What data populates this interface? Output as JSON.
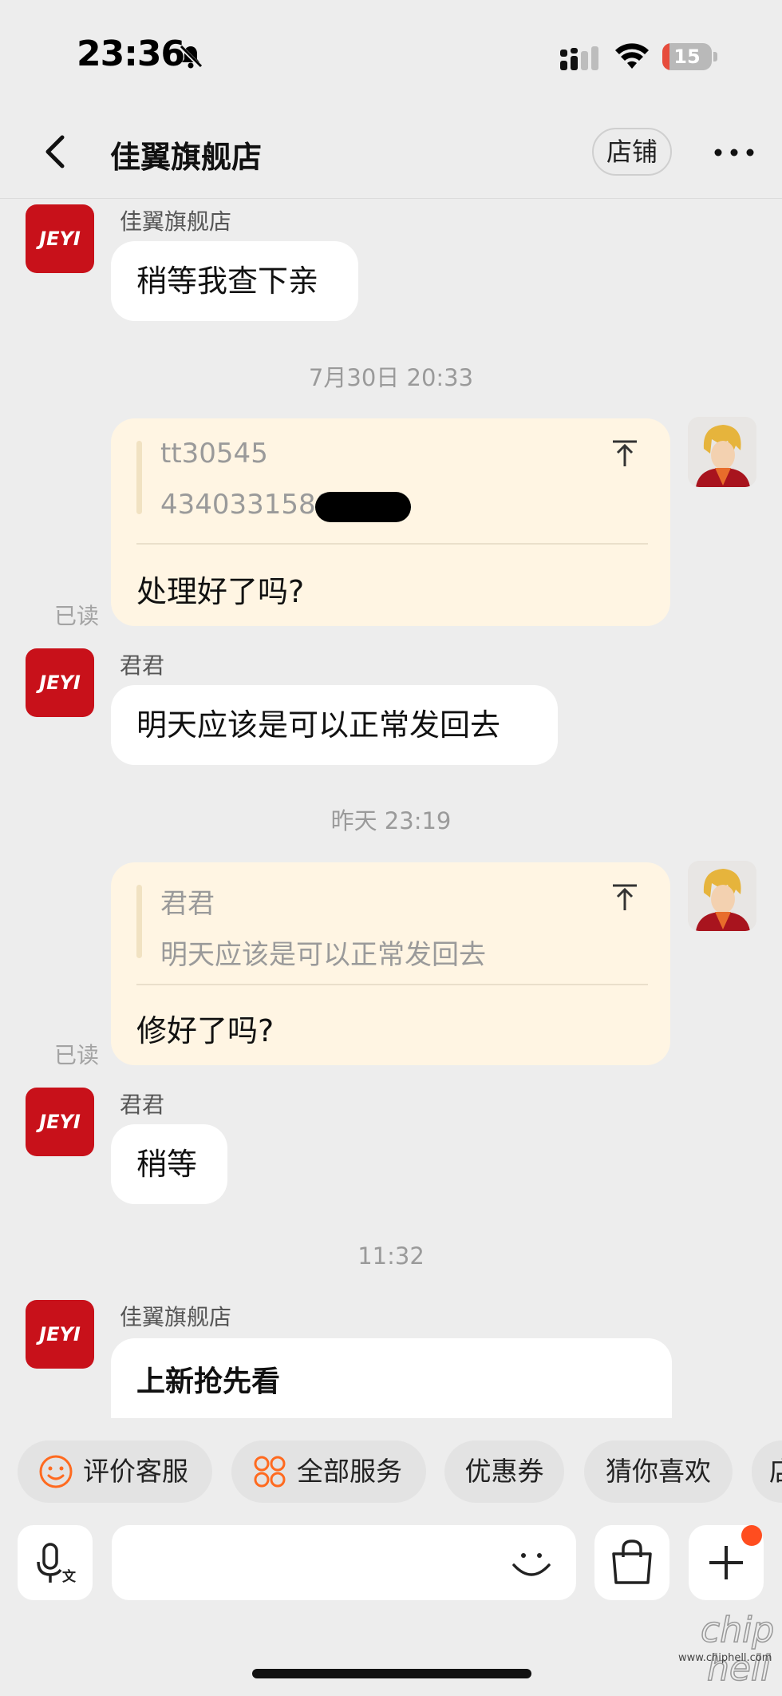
{
  "status_bar": {
    "time": "23:36",
    "battery": "15",
    "battery_level_percent": 15
  },
  "nav": {
    "title": "佳翼旗舰店",
    "store_button": "店铺"
  },
  "messages": {
    "m1": {
      "sender": "佳翼旗舰店",
      "avatar_text": "JEYI",
      "text": "稍等我查下亲"
    },
    "t1": "7月30日 20:33",
    "q1": {
      "line1": "tt30545",
      "line2": "4340331580",
      "text": "处理好了吗?",
      "read": "已读"
    },
    "m2": {
      "sender": "君君",
      "avatar_text": "JEYI",
      "text": "明天应该是可以正常发回去"
    },
    "t2": "昨天 23:19",
    "q2": {
      "line1": "君君",
      "line2": "明天应该是可以正常发回去",
      "text": "修好了吗?",
      "read": "已读"
    },
    "m3": {
      "sender": "君君",
      "avatar_text": "JEYI",
      "text": "稍等"
    },
    "t3": "11:32",
    "m4": {
      "sender": "佳翼旗舰店",
      "avatar_text": "JEYI",
      "text": "上新抢先看"
    }
  },
  "chips": [
    {
      "label": "评价客服",
      "icon": "smile-icon"
    },
    {
      "label": "全部服务",
      "icon": "services-grid-icon"
    },
    {
      "label": "优惠券"
    },
    {
      "label": "猜你喜欢"
    },
    {
      "label": "店"
    }
  ],
  "input": {
    "placeholder": ""
  },
  "watermark": {
    "site": "www.chiphell.com",
    "logo": "chip hell"
  },
  "colors": {
    "shop_red": "#c8111a",
    "quote_bg": "#fff5e3",
    "accent_orange": "#ff6a1f"
  }
}
